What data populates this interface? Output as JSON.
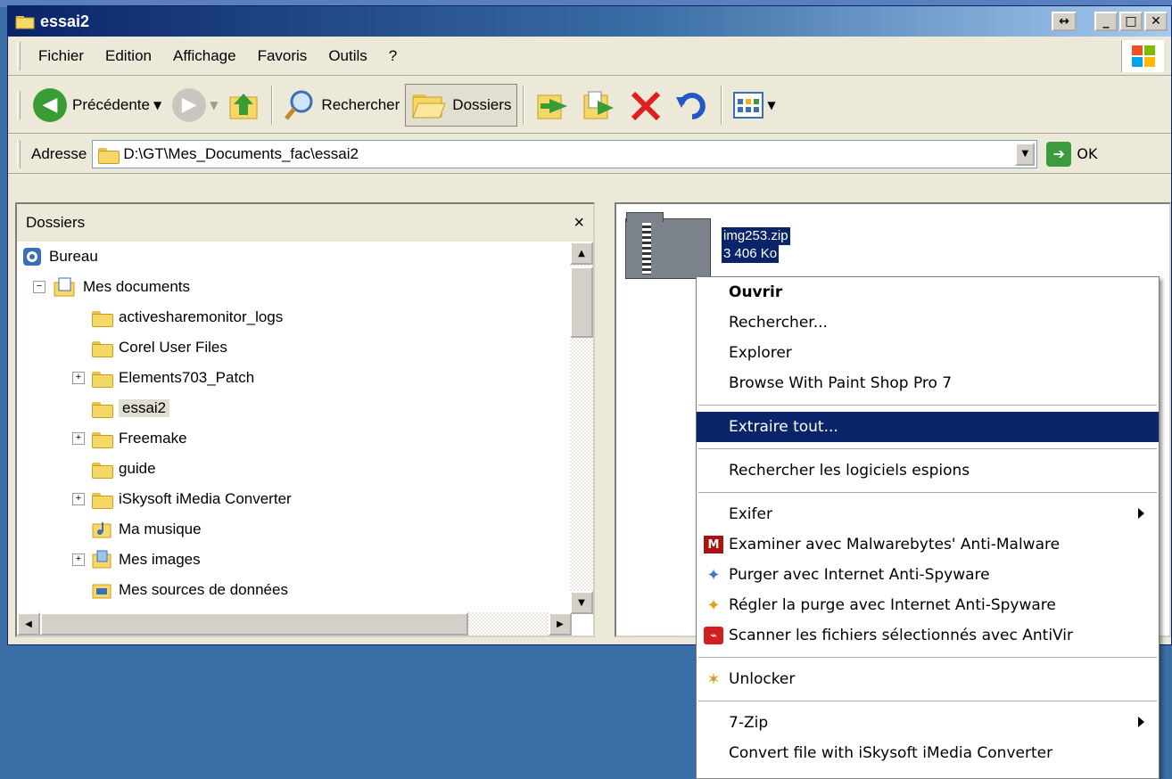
{
  "window": {
    "title": "essai2"
  },
  "menubar": {
    "items": [
      "Fichier",
      "Edition",
      "Affichage",
      "Favoris",
      "Outils",
      "?"
    ]
  },
  "toolbar": {
    "back_label": "Précédente",
    "search_label": "Rechercher",
    "folders_label": "Dossiers"
  },
  "address": {
    "label": "Adresse",
    "value": "D:\\GT\\Mes_Documents_fac\\essai2",
    "go_label": "OK"
  },
  "folders": {
    "header": "Dossiers",
    "close": "×",
    "tree": [
      {
        "label": "Bureau",
        "icon": "desktop-icon",
        "expander": ""
      },
      {
        "label": "Mes documents",
        "icon": "documents-icon",
        "expander": "−"
      },
      {
        "label": "activesharemonitor_logs",
        "icon": "folder-icon",
        "expander": ""
      },
      {
        "label": "Corel User Files",
        "icon": "folder-icon",
        "expander": ""
      },
      {
        "label": "Elements703_Patch",
        "icon": "folder-icon",
        "expander": "+"
      },
      {
        "label": "essai2",
        "icon": "folder-icon",
        "expander": "",
        "selected": true
      },
      {
        "label": "Freemake",
        "icon": "folder-icon",
        "expander": "+"
      },
      {
        "label": "guide",
        "icon": "folder-icon",
        "expander": ""
      },
      {
        "label": "iSkysoft iMedia Converter",
        "icon": "folder-icon",
        "expander": "+"
      },
      {
        "label": "Ma musique",
        "icon": "music-folder-icon",
        "expander": ""
      },
      {
        "label": "Mes images",
        "icon": "pictures-folder-icon",
        "expander": "+"
      },
      {
        "label": "Mes sources de données",
        "icon": "data-sources-icon",
        "expander": ""
      }
    ]
  },
  "file": {
    "name": "img253.zip",
    "size": "3 406 Ko"
  },
  "context_menu": {
    "items": [
      {
        "label": "Ouvrir",
        "bold": true
      },
      {
        "label": "Rechercher..."
      },
      {
        "label": "Explorer"
      },
      {
        "label": "Browse With Paint Shop Pro 7"
      },
      {
        "sep": true
      },
      {
        "label": "Extraire tout...",
        "highlighted": true
      },
      {
        "sep": true
      },
      {
        "label": "Rechercher les logiciels espions"
      },
      {
        "sep": true
      },
      {
        "label": "Exifer",
        "submenu": true
      },
      {
        "label": "Examiner avec Malwarebytes' Anti-Malware",
        "icon": "malwarebytes-icon",
        "icon_glyph": "M",
        "icon_color": "#b01010"
      },
      {
        "label": "Purger avec Internet Anti-Spyware",
        "icon": "broom-icon",
        "icon_glyph": "✦",
        "icon_color": "#3a78d4"
      },
      {
        "label": "Régler la purge avec Internet Anti-Spyware",
        "icon": "broom-settings-icon",
        "icon_glyph": "✦",
        "icon_color": "#e0a020"
      },
      {
        "label": "Scanner les fichiers sélectionnés avec AntiVir",
        "icon": "antivir-icon",
        "icon_glyph": "⌁",
        "icon_color": "#d22020"
      },
      {
        "sep": true
      },
      {
        "label": "Unlocker",
        "icon": "unlocker-icon",
        "icon_glyph": "✶",
        "icon_color": "#c8a020"
      },
      {
        "sep": true
      },
      {
        "label": "7-Zip",
        "submenu": true
      },
      {
        "label": "Convert file with iSkysoft iMedia Converter"
      }
    ]
  },
  "colors": {
    "titlebar_start": "#0a246a",
    "selection": "#0a246a",
    "desktop": "#3a6ea5"
  }
}
